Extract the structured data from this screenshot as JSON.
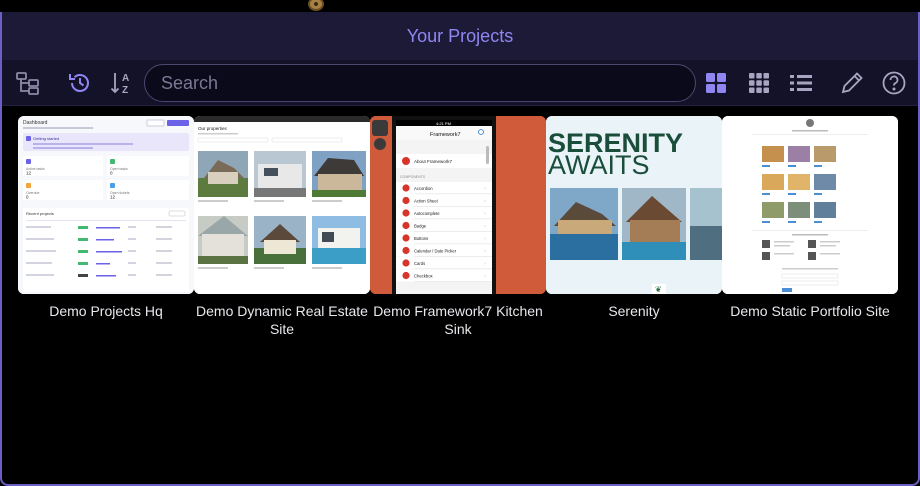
{
  "window": {
    "title": "Your Projects"
  },
  "toolbar": {
    "search": {
      "placeholder": "Search",
      "value": ""
    },
    "icons": [
      "hierarchy-icon",
      "history-icon",
      "sort-az-icon",
      "large-grid-icon",
      "small-grid-icon",
      "list-view-icon",
      "edit-icon",
      "help-icon"
    ],
    "accent": "#8f86f2",
    "active_view": "large-grid"
  },
  "projects": [
    {
      "name": "Demo Projects Hq",
      "thumb": {
        "heading": "Dashboard",
        "alert": "Getting started",
        "stats": [
          {
            "label": "Active tasks",
            "value": "12"
          },
          {
            "label": "Open tasks",
            "value": "0"
          },
          {
            "label": "Overdue",
            "value": "0"
          },
          {
            "label": "Open tickets",
            "value": "12"
          }
        ],
        "table_title": "Recent projects"
      }
    },
    {
      "name": "Demo Dynamic Real Estate Site",
      "thumb": {
        "heading": "Our properties"
      }
    },
    {
      "name": "Demo Framework7 Kitchen Sink",
      "thumb": {
        "status_time": "4:21 PM",
        "nav_title": "Framework7",
        "first_item": "About Framework7",
        "section": "COMPONENTS",
        "items": [
          "Accordion",
          "Action Sheet",
          "Autocomplete",
          "Badge",
          "Buttons",
          "Calendar / Date Picker",
          "Cards",
          "Checkbox"
        ]
      }
    },
    {
      "name": "Serenity",
      "thumb": {
        "line1": "SERENITY",
        "line2": "AWAITS"
      }
    },
    {
      "name": "Demo Static Portfolio Site",
      "thumb": {}
    }
  ]
}
